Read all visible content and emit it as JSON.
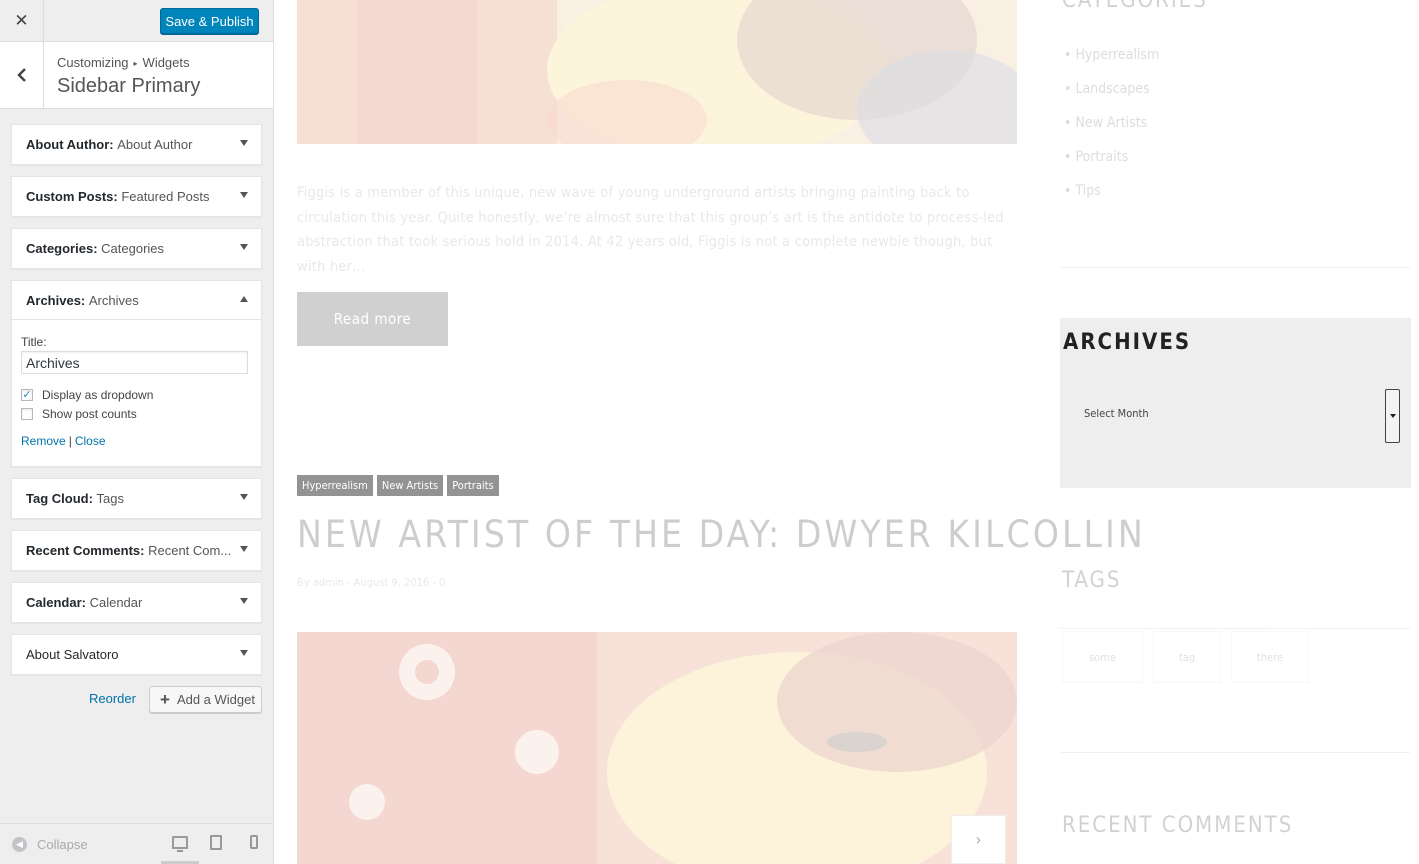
{
  "customizer": {
    "close_label": "✕",
    "save_publish": "Save & Publish",
    "breadcrumb": {
      "root": "Customizing",
      "separator": "▸",
      "current": "Widgets"
    },
    "panel_title": "Sidebar Primary",
    "widgets": [
      {
        "type": "About Author:",
        "name": "About Author"
      },
      {
        "type": "Custom Posts:",
        "name": "Featured Posts"
      },
      {
        "type": "Categories:",
        "name": "Categories"
      },
      {
        "type": "Archives:",
        "name": "Archives"
      },
      {
        "type": "Tag Cloud:",
        "name": "Tags"
      },
      {
        "type": "Recent Comments:",
        "name": "Recent Com..."
      },
      {
        "type": "Calendar:",
        "name": "Calendar"
      },
      {
        "type": "About Salvatoro",
        "name": ""
      }
    ],
    "archives_form": {
      "title_label": "Title:",
      "title_value": "Archives",
      "dropdown_label": "Display as dropdown",
      "dropdown_checked": true,
      "counts_label": "Show post counts",
      "counts_checked": false,
      "remove": "Remove",
      "separator": "|",
      "close": "Close"
    },
    "reorder": "Reorder",
    "add_widget": "Add a Widget",
    "collapse": "Collapse",
    "accent_color": "#0085ba"
  },
  "preview": {
    "excerpt": "Figgis is a member of this unique, new wave of young underground artists bringing painting back to circulation this year. Quite honestly, we’re almost sure that this group’s art is the antidote to process-led abstraction that took serious hold in 2014. At 42 years old, Figgis is not a complete newbie though, but with her…",
    "read_more": "Read more",
    "post_tags": [
      "Hyperrealism",
      "New Artists",
      "Portraits"
    ],
    "post_title": "NEW ARTIST OF THE DAY: DWYER KILCOLLIN",
    "post_meta": "By admin - August 9, 2016 - 0",
    "sidebar": {
      "categories_heading": "CATEGORIES",
      "categories": [
        "Hyperrealism",
        "Landscapes",
        "New Artists",
        "Portraits",
        "Tips"
      ],
      "archives_heading": "ARCHIVES",
      "archives_select": "Select Month",
      "tags_heading": "TAGS",
      "tag_cloud": [
        "some",
        "tag",
        "there"
      ],
      "recent_comments_heading": "RECENT COMMENTS"
    },
    "slider_next": "›"
  }
}
